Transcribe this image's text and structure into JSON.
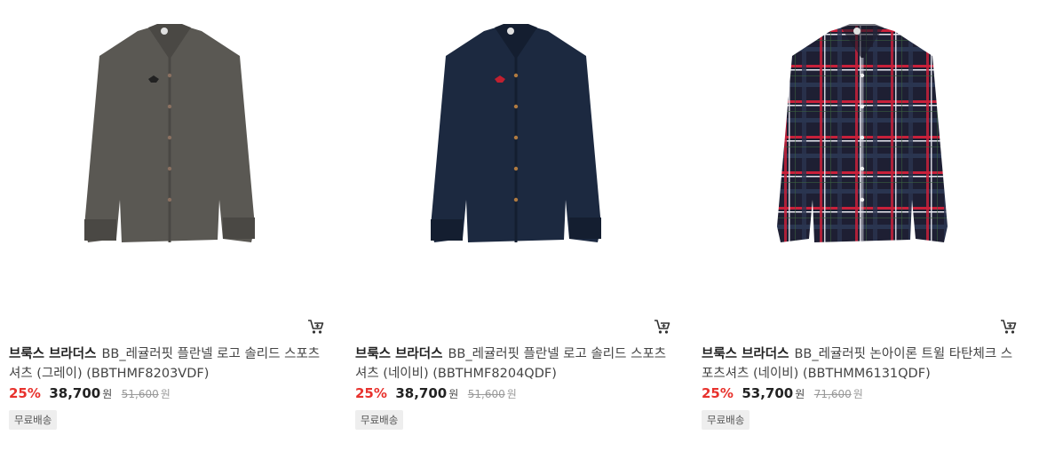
{
  "products": [
    {
      "brand": "브룩스 브라더스",
      "name": "BB_레귤러핏 플란넬 로고 솔리드 스포츠셔츠 (그레이) (BBTHMF8203VDF)",
      "discount": "25%",
      "price": "38,700",
      "price_unit": "원",
      "original_price": "51,600",
      "original_unit": "원",
      "badge": "무료배송",
      "image_icon": "grey-shirt-image",
      "shirt_color": "#5a5853"
    },
    {
      "brand": "브룩스 브라더스",
      "name": "BB_레귤러핏 플란넬 로고 솔리드 스포츠셔츠 (네이비) (BBTHMF8204QDF)",
      "discount": "25%",
      "price": "38,700",
      "price_unit": "원",
      "original_price": "51,600",
      "original_unit": "원",
      "badge": "무료배송",
      "image_icon": "navy-shirt-image",
      "shirt_color": "#1c2940"
    },
    {
      "brand": "브룩스 브라더스",
      "name": "BB_레귤러핏 논아이론 트윌 타탄체크 스포츠셔츠 (네이비) (BBTHMM6131QDF)",
      "discount": "25%",
      "price": "53,700",
      "price_unit": "원",
      "original_price": "71,600",
      "original_unit": "원",
      "badge": "무료배송",
      "image_icon": "plaid-shirt-image",
      "shirt_color": "#1e1f33"
    }
  ],
  "icons": {
    "cart": "cart-icon"
  },
  "colors": {
    "discount": "#e8322d",
    "badge_bg": "#eeeeee"
  }
}
